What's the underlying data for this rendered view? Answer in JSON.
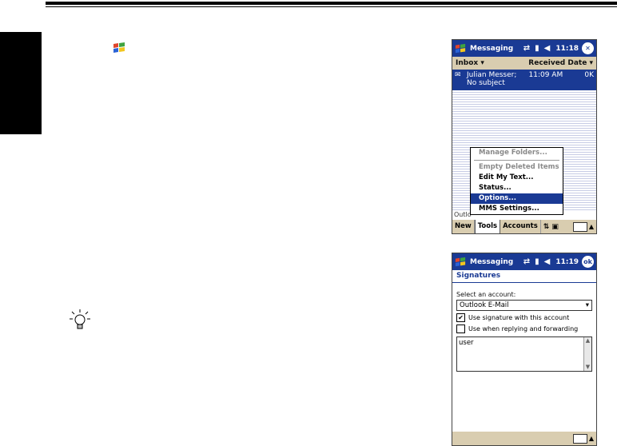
{
  "screen1": {
    "title": "Messaging",
    "time": "11:18",
    "close_glyph": "✕",
    "folder": "Inbox",
    "sort": "Received Date",
    "message": {
      "sender": "Julian Messer;",
      "time": "11:09 AM",
      "size": "0K",
      "subject": "No subject"
    },
    "status_left": "Outlo",
    "menu": [
      {
        "label": "Manage Folders...",
        "state": "disabled"
      },
      {
        "label": "Empty Deleted Items",
        "state": "disabled"
      },
      {
        "label": "Edit My Text...",
        "state": "normal"
      },
      {
        "label": "Status...",
        "state": "normal"
      },
      {
        "label": "Options...",
        "state": "selected"
      },
      {
        "label": "MMS Settings...",
        "state": "normal"
      }
    ],
    "bottom": {
      "new": "New",
      "tools": "Tools",
      "accounts": "Accounts"
    }
  },
  "screen2": {
    "title": "Messaging",
    "time": "11:19",
    "ok": "ok",
    "section": "Signatures",
    "select_label": "Select an account:",
    "account": "Outlook E-Mail",
    "use_signature": "Use signature with this account",
    "use_when_replying": "Use when replying and forwarding",
    "signature_text": "user"
  },
  "colors": {
    "titlebar": "#1a3a94",
    "bars": "#d9cdb0"
  }
}
